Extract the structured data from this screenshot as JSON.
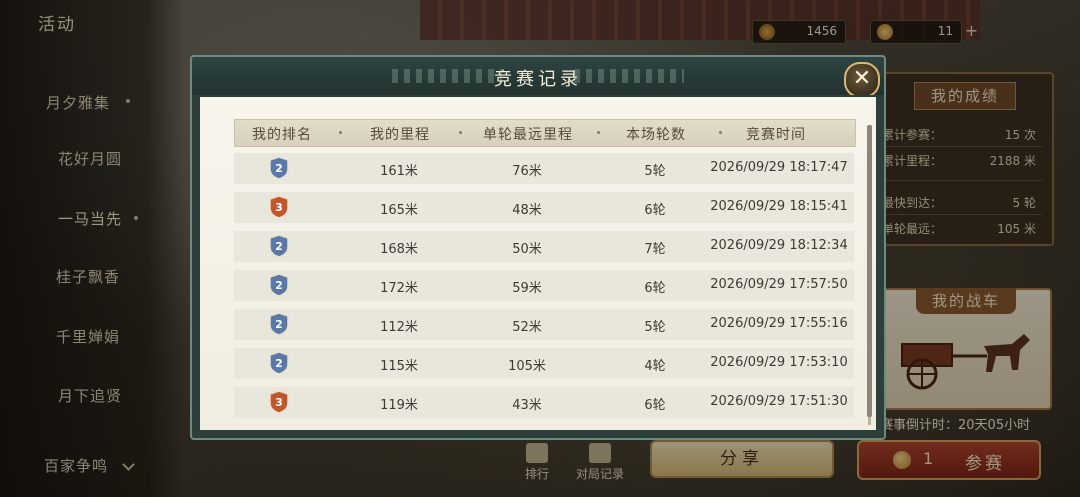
{
  "sidebar": {
    "title": "活动",
    "items": [
      {
        "label": "月夕雅集"
      },
      {
        "label": "花好月圆"
      },
      {
        "label": "一马当先"
      },
      {
        "label": "桂子飘香"
      },
      {
        "label": "千里婵娟"
      },
      {
        "label": "月下追贤"
      },
      {
        "label": "百家争鸣"
      }
    ]
  },
  "resources": {
    "res1_value": "1456",
    "res2_value": "11",
    "add_label": "+"
  },
  "modal": {
    "title": "竞赛记录",
    "close_label": "✕",
    "columns": [
      "我的排名",
      "我的里程",
      "单轮最远里程",
      "本场轮数",
      "竞赛时间"
    ],
    "rows": [
      {
        "rank": "2",
        "distance": "161米",
        "best": "76米",
        "rounds": "5轮",
        "time": "2026/09/29 18:17:47"
      },
      {
        "rank": "3",
        "distance": "165米",
        "best": "48米",
        "rounds": "6轮",
        "time": "2026/09/29 18:15:41"
      },
      {
        "rank": "2",
        "distance": "168米",
        "best": "50米",
        "rounds": "7轮",
        "time": "2026/09/29 18:12:34"
      },
      {
        "rank": "2",
        "distance": "172米",
        "best": "59米",
        "rounds": "6轮",
        "time": "2026/09/29 17:57:50"
      },
      {
        "rank": "2",
        "distance": "112米",
        "best": "52米",
        "rounds": "5轮",
        "time": "2026/09/29 17:55:16"
      },
      {
        "rank": "2",
        "distance": "115米",
        "best": "105米",
        "rounds": "4轮",
        "time": "2026/09/29 17:53:10"
      },
      {
        "rank": "3",
        "distance": "119米",
        "best": "43米",
        "rounds": "6轮",
        "time": "2026/09/29 17:51:30"
      }
    ],
    "badge_colors": {
      "2": "#5a78a8",
      "3": "#c0562c"
    }
  },
  "stats": {
    "title": "我的成绩",
    "rows": [
      {
        "label": "累计参赛：",
        "value": "15 次"
      },
      {
        "label": "累计里程：",
        "value": "2188 米"
      },
      {
        "label": "最快到达：",
        "value": "5 轮"
      },
      {
        "label": "单轮最远：",
        "value": "105 米"
      }
    ]
  },
  "cart": {
    "title": "我的战车"
  },
  "countdown": "赛事倒计时：20天05小时",
  "buttons": {
    "rank": "排行",
    "records": "对局记录",
    "share": "分享",
    "join_count": "1",
    "join": "参赛"
  }
}
